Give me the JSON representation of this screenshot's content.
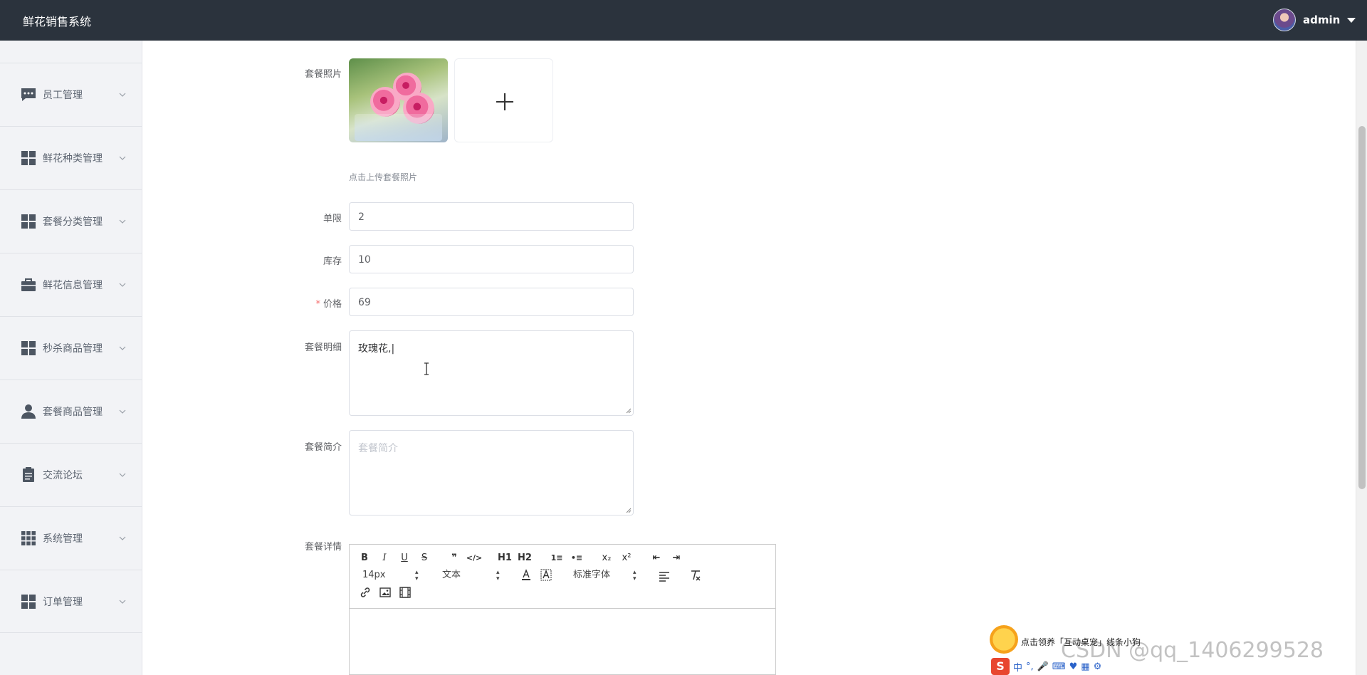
{
  "app": {
    "title": "鲜花销售系统"
  },
  "user": {
    "name": "admin"
  },
  "sidebar": {
    "items": [
      {
        "label": "员工管理",
        "icon": "chat-icon"
      },
      {
        "label": "鲜花种类管理",
        "icon": "grid-icon"
      },
      {
        "label": "套餐分类管理",
        "icon": "grid-icon"
      },
      {
        "label": "鲜花信息管理",
        "icon": "briefcase-icon"
      },
      {
        "label": "秒杀商品管理",
        "icon": "grid-icon"
      },
      {
        "label": "套餐商品管理",
        "icon": "person-icon"
      },
      {
        "label": "交流论坛",
        "icon": "clipboard-icon"
      },
      {
        "label": "系统管理",
        "icon": "apps-icon"
      },
      {
        "label": "订单管理",
        "icon": "grid-icon"
      }
    ]
  },
  "form": {
    "photo_label": "套餐照片",
    "photo_hint": "点击上传套餐照片",
    "limit_label": "单限",
    "limit_value": "2",
    "stock_label": "库存",
    "stock_value": "10",
    "price_required": "*",
    "price_label": "价格",
    "price_value": "69",
    "detail_label": "套餐明细",
    "detail_value": "玫瑰花,|",
    "intro_label": "套餐简介",
    "intro_placeholder": "套餐简介",
    "content_label": "套餐详情"
  },
  "editor": {
    "row1": [
      "B",
      "I",
      "U",
      "S",
      "❞",
      "</>",
      "H1",
      "H2",
      "1≡",
      "•≡",
      "x₂",
      "x²",
      "⇤",
      "⇥"
    ],
    "font_size": "14px",
    "text_style": "文本",
    "font_family": "标准字体"
  },
  "overlay": {
    "promo_text": "点击领养「互动桌宠」线条小狗",
    "watermark": "CSDN @qq_1406299528",
    "ime_label": "中"
  }
}
